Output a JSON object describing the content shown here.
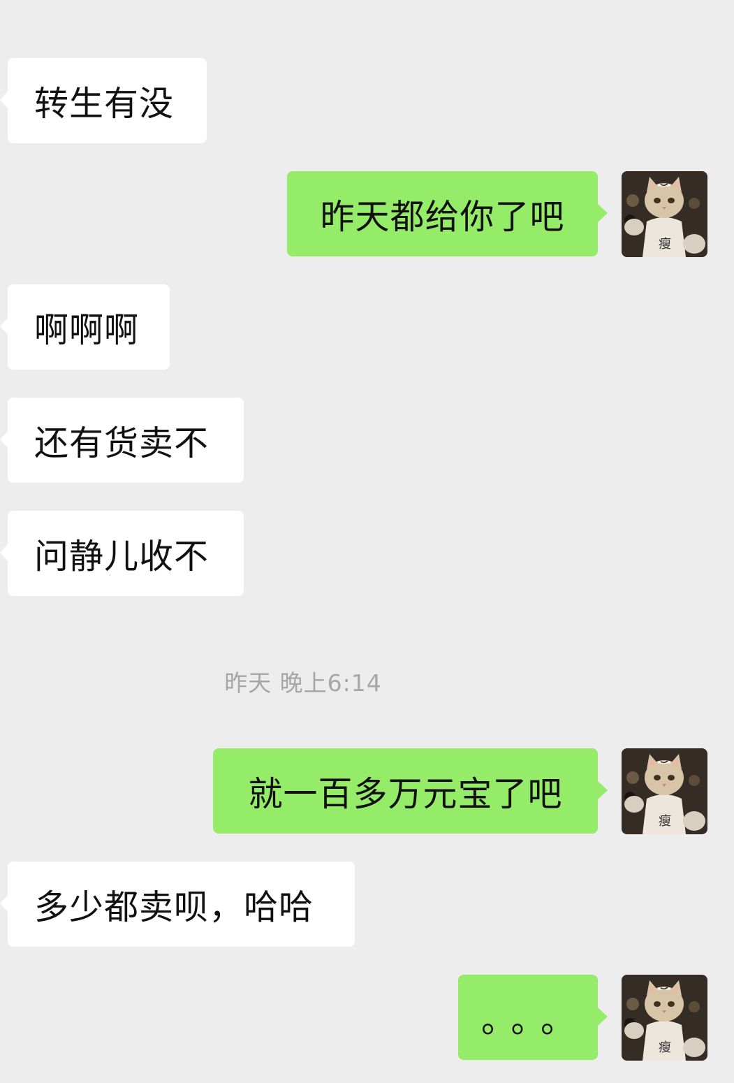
{
  "messages": [
    {
      "direction": "in",
      "text": "转生有没"
    },
    {
      "direction": "out",
      "text": "昨天都给你了吧"
    },
    {
      "direction": "in",
      "text": "啊啊啊"
    },
    {
      "direction": "in",
      "text": "还有货卖不"
    },
    {
      "direction": "in",
      "text": "问静儿收不"
    },
    {
      "direction": "out",
      "text": "就一百多万元宝了吧"
    },
    {
      "direction": "in",
      "text": "多少都卖呗，哈哈"
    },
    {
      "direction": "out",
      "text": "。。。"
    }
  ],
  "timestamp": "昨天 晚上6:14",
  "avatar": {
    "description": "cat-avatar-icon",
    "badge_text": "瘦"
  },
  "colors": {
    "background": "#ededed",
    "incoming_bubble": "#ffffff",
    "outgoing_bubble": "#95ec69",
    "text": "#111111",
    "timestamp": "#a6a6a6"
  }
}
